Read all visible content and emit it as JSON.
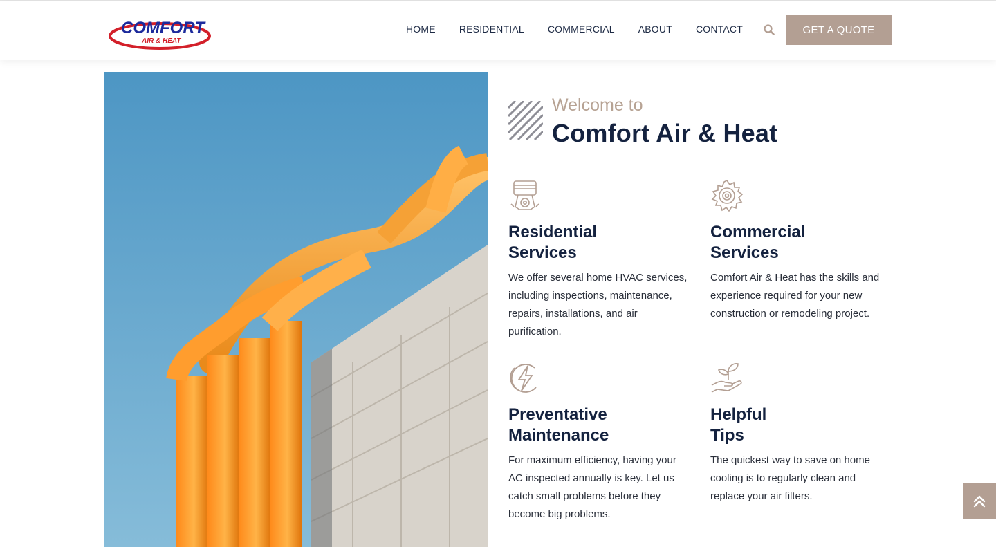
{
  "header": {
    "logo_main": "COMFORT",
    "logo_sub": "AIR & HEAT",
    "nav": [
      "HOME",
      "RESIDENTIAL",
      "COMMERCIAL",
      "ABOUT",
      "CONTACT"
    ],
    "search_icon": "search-icon",
    "cta_label": "GET A QUOTE"
  },
  "intro": {
    "welcome": "Welcome to",
    "company": "Comfort Air & Heat"
  },
  "services": [
    {
      "icon": "piston-icon",
      "title_line1": "Residential",
      "title_line2": "Services",
      "text": "We offer several home HVAC services, including inspections, maintenance, repairs, installations, and air purification."
    },
    {
      "icon": "gear-icon",
      "title_line1": "Commercial",
      "title_line2": "Services",
      "text": "Comfort Air & Heat has the skills and experience required for your new construction or remodeling project."
    },
    {
      "icon": "lightning-icon",
      "title_line1": "Preventative",
      "title_line2": "Maintenance",
      "text": "For maximum efficiency, having your AC inspected annually is key. Let us catch small problems before they become big problems."
    },
    {
      "icon": "hand-plant-icon",
      "title_line1": "Helpful",
      "title_line2": "Tips",
      "text": "The quickest way to save on home cooling is to regularly clean and replace your air filters."
    }
  ],
  "colors": {
    "accent": "#b39f93",
    "heading": "#14223f",
    "logo_blue": "#1c2a9c",
    "logo_red": "#d3202a"
  },
  "back_to_top_icon": "double-chevron-up-icon"
}
